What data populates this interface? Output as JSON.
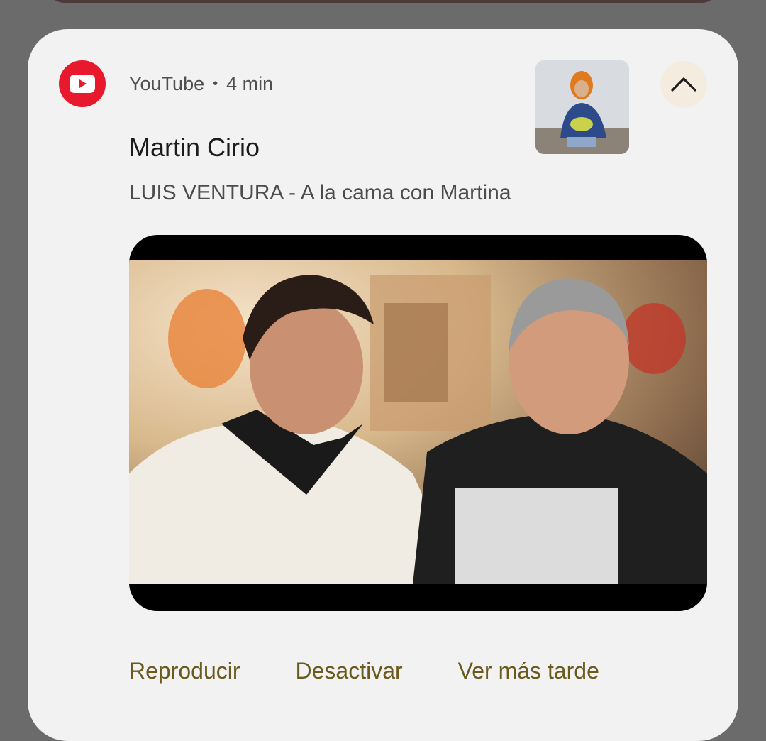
{
  "notification": {
    "app_name": "YouTube",
    "separator": "•",
    "time": "4 min",
    "title": "Martin Cirio",
    "text": "LUIS VENTURA - A la cama con Martina",
    "actions": {
      "play": "Reproducir",
      "disable": "Desactivar",
      "watch_later": "Ver más tarde"
    }
  },
  "icons": {
    "app_icon": "youtube-icon",
    "expand": "chevron-up-icon"
  },
  "colors": {
    "app_brand": "#e8192c",
    "card_bg": "#f2f2f2",
    "action_text": "#6b5a1e",
    "expand_bg": "#f5ece0"
  }
}
